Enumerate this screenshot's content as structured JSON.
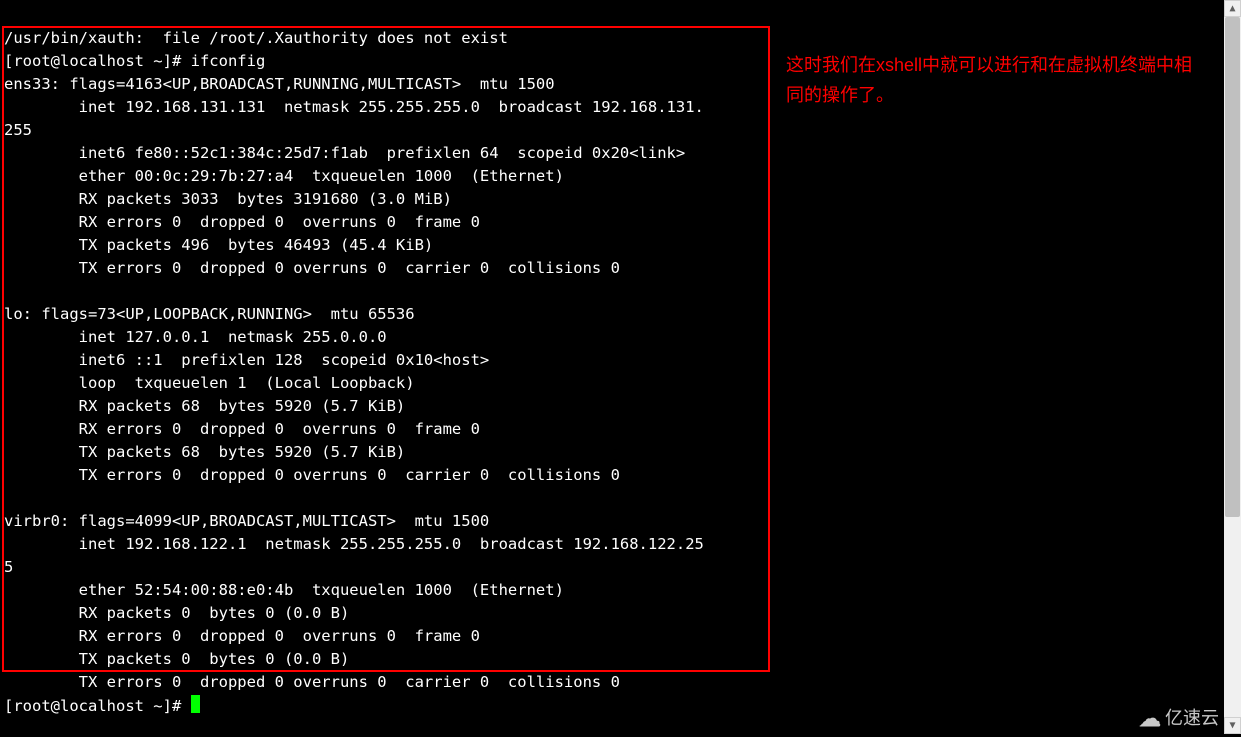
{
  "xauth": "/usr/bin/xauth:  file /root/.Xauthority does not exist",
  "prompt": "[root@localhost ~]# ",
  "cmd": "ifconfig",
  "ens33": {
    "l1": "ens33: flags=4163<UP,BROADCAST,RUNNING,MULTICAST>  mtu 1500",
    "l2": "        inet 192.168.131.131  netmask 255.255.255.0  broadcast 192.168.131.",
    "l2b": "255",
    "l3": "        inet6 fe80::52c1:384c:25d7:f1ab  prefixlen 64  scopeid 0x20<link>",
    "l4": "        ether 00:0c:29:7b:27:a4  txqueuelen 1000  (Ethernet)",
    "l5": "        RX packets 3033  bytes 3191680 (3.0 MiB)",
    "l6": "        RX errors 0  dropped 0  overruns 0  frame 0",
    "l7": "        TX packets 496  bytes 46493 (45.4 KiB)",
    "l8": "        TX errors 0  dropped 0 overruns 0  carrier 0  collisions 0"
  },
  "lo": {
    "l1": "lo: flags=73<UP,LOOPBACK,RUNNING>  mtu 65536",
    "l2": "        inet 127.0.0.1  netmask 255.0.0.0",
    "l3": "        inet6 ::1  prefixlen 128  scopeid 0x10<host>",
    "l4": "        loop  txqueuelen 1  (Local Loopback)",
    "l5": "        RX packets 68  bytes 5920 (5.7 KiB)",
    "l6": "        RX errors 0  dropped 0  overruns 0  frame 0",
    "l7": "        TX packets 68  bytes 5920 (5.7 KiB)",
    "l8": "        TX errors 0  dropped 0 overruns 0  carrier 0  collisions 0"
  },
  "virbr0": {
    "l1": "virbr0: flags=4099<UP,BROADCAST,MULTICAST>  mtu 1500",
    "l2": "        inet 192.168.122.1  netmask 255.255.255.0  broadcast 192.168.122.25",
    "l2b": "5",
    "l3": "        ether 52:54:00:88:e0:4b  txqueuelen 1000  (Ethernet)",
    "l4": "        RX packets 0  bytes 0 (0.0 B)",
    "l5": "        RX errors 0  dropped 0  overruns 0  frame 0",
    "l6": "        TX packets 0  bytes 0 (0.0 B)",
    "l7": "        TX errors 0  dropped 0 overruns 0  carrier 0  collisions 0"
  },
  "annot": "这时我们在xshell中就可以进行和在虚拟机终端中相同的操作了。",
  "logo": "亿速云"
}
